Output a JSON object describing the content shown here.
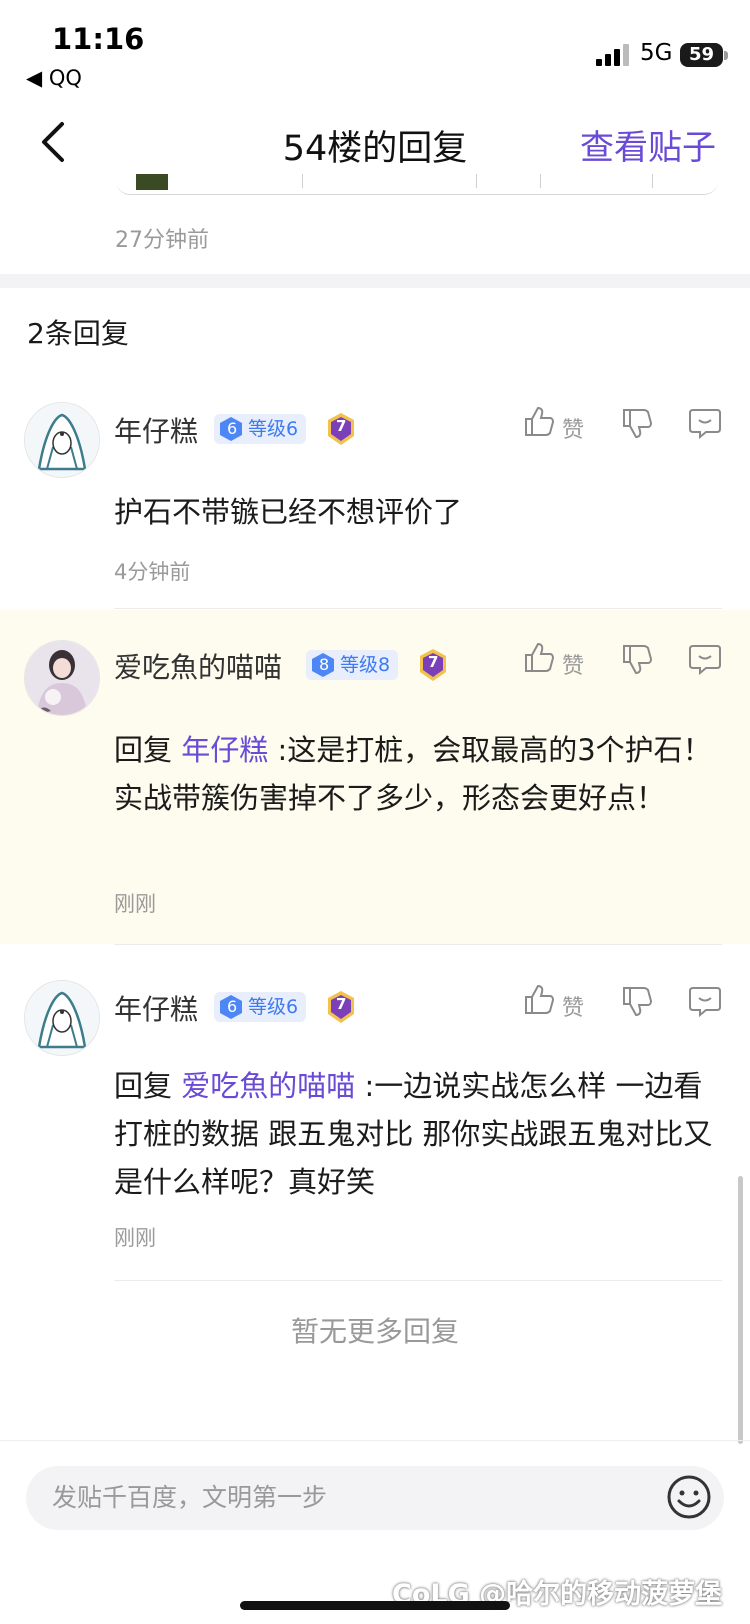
{
  "status_bar": {
    "time": "11:16",
    "back_app": "◀ QQ",
    "network": "5G",
    "battery": "59"
  },
  "nav": {
    "title": "54楼的回复",
    "action": "查看贴子"
  },
  "top_post": {
    "time": "27分钟前"
  },
  "reply_count": "2条回复",
  "replies": [
    {
      "user": "年仔糕",
      "gem": "6",
      "level": "等级6",
      "medal": "7",
      "like": "赞",
      "content": "护石不带镞已经不想评价了",
      "time": "4分钟前"
    },
    {
      "user": "爱吃魚的喵喵",
      "gem": "8",
      "level": "等级8",
      "medal": "7",
      "like": "赞",
      "reply_prefix": "回复 ",
      "mention": "年仔糕",
      "content": " :这是打桩，会取最高的3个护石！实战带簇伤害掉不了多少，形态会更好点！",
      "time": "刚刚"
    },
    {
      "user": "年仔糕",
      "gem": "6",
      "level": "等级6",
      "medal": "7",
      "like": "赞",
      "reply_prefix": "回复 ",
      "mention": "爱吃魚的喵喵",
      "content": " :一边说实战怎么样 一边看打桩的数据 跟五鬼对比 那你实战跟五鬼对比又是什么样呢？真好笑",
      "time": "刚刚"
    }
  ],
  "no_more": "暂无更多回复",
  "input": {
    "placeholder": "发贴千百度，文明第一步"
  },
  "watermark": "CoLG @哈尔的移动菠萝堡",
  "colors": {
    "accent": "#6a4bd6",
    "level_blue": "#3f7bf0",
    "highlight_bg": "#fdfcee"
  }
}
